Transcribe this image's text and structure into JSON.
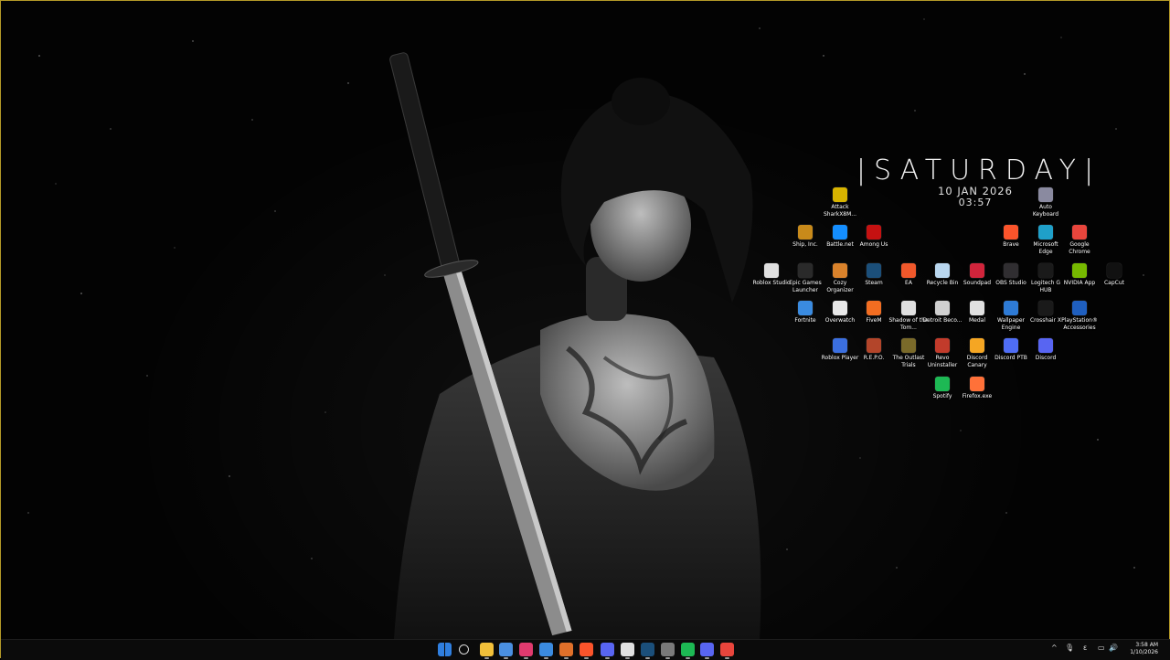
{
  "widget": {
    "day": "|SATURDAY|",
    "date": "10 JAN 2026",
    "time": "03:57"
  },
  "desktop_icons": [
    {
      "label": "Attack SharkX8M...",
      "icon": "attack-shark-icon",
      "color": "#d8b400"
    },
    {
      "label": "Auto Keyboard",
      "icon": "keyboard-icon",
      "color": "#8a8aa0"
    },
    {
      "label": "Ship, Inc.",
      "icon": "ship-inc-icon",
      "color": "#c88a1a"
    },
    {
      "label": "Battle.net",
      "icon": "battlenet-icon",
      "color": "#148eff"
    },
    {
      "label": "Among Us",
      "icon": "among-us-icon",
      "color": "#c51111"
    },
    {
      "label": "Brave",
      "icon": "brave-icon",
      "color": "#fb542b"
    },
    {
      "label": "Microsoft Edge",
      "icon": "edge-icon",
      "color": "#1fa0c9"
    },
    {
      "label": "Google Chrome",
      "icon": "chrome-icon",
      "color": "#e8453c"
    },
    {
      "label": "Roblox Studio",
      "icon": "roblox-studio-icon",
      "color": "#e0e0e0"
    },
    {
      "label": "Epic Games Launcher",
      "icon": "epic-games-icon",
      "color": "#2a2a2a"
    },
    {
      "label": "Cozy Organizer",
      "icon": "cozy-organizer-icon",
      "color": "#d9822b"
    },
    {
      "label": "Steam",
      "icon": "steam-icon",
      "color": "#1b4f7a"
    },
    {
      "label": "EA",
      "icon": "ea-icon",
      "color": "#f0582b"
    },
    {
      "label": "Recycle Bin",
      "icon": "recycle-bin-icon",
      "color": "#b9d7ef"
    },
    {
      "label": "Soundpad",
      "icon": "soundpad-icon",
      "color": "#d1243b"
    },
    {
      "label": "OBS Studio",
      "icon": "obs-icon",
      "color": "#302e31"
    },
    {
      "label": "Logitech G HUB",
      "icon": "logitech-icon",
      "color": "#1a1a1a"
    },
    {
      "label": "NVIDIA App",
      "icon": "nvidia-icon",
      "color": "#76b900"
    },
    {
      "label": "CapCut",
      "icon": "capcut-icon",
      "color": "#111111"
    },
    {
      "label": "Fortnite",
      "icon": "fortnite-icon",
      "color": "#3a8be0"
    },
    {
      "label": "Overwatch",
      "icon": "overwatch-icon",
      "color": "#e8e8e8"
    },
    {
      "label": "FiveM",
      "icon": "fivem-icon",
      "color": "#f26d21"
    },
    {
      "label": "Shadow of the Tom...",
      "icon": "shadow-tomb-raider-icon",
      "color": "#e0e0e0"
    },
    {
      "label": "Detroit Beco...",
      "icon": "detroit-icon",
      "color": "#d0d0d0"
    },
    {
      "label": "Medal",
      "icon": "medal-icon",
      "color": "#e0e0e0"
    },
    {
      "label": "Wallpaper Engine",
      "icon": "wallpaper-engine-icon",
      "color": "#2e7bd6"
    },
    {
      "label": "Crosshair X",
      "icon": "crosshair-x-icon",
      "color": "#1a1a1a"
    },
    {
      "label": "PlayStation® Accessories",
      "icon": "playstation-icon",
      "color": "#1f5fbf"
    },
    {
      "label": "Roblox Player",
      "icon": "roblox-player-icon",
      "color": "#3b6fe0"
    },
    {
      "label": "R.E.P.O.",
      "icon": "repo-icon",
      "color": "#b3452a"
    },
    {
      "label": "The Outlast Trials",
      "icon": "outlast-icon",
      "color": "#7a6a2a"
    },
    {
      "label": "Revo Uninstaller",
      "icon": "revo-icon",
      "color": "#c23b2b"
    },
    {
      "label": "Discord Canary",
      "icon": "discord-canary-icon",
      "color": "#f5a623"
    },
    {
      "label": "Discord PTB",
      "icon": "discord-ptb-icon",
      "color": "#4f6df5"
    },
    {
      "label": "Discord",
      "icon": "discord-icon",
      "color": "#5865f2"
    },
    {
      "label": "Spotify",
      "icon": "spotify-icon",
      "color": "#1db954"
    },
    {
      "label": "Firefox.exe",
      "icon": "firefox-icon",
      "color": "#ff7139"
    }
  ],
  "taskbar": {
    "pinned": [
      {
        "icon": "windows-start-icon",
        "color": "#2f7fe0"
      },
      {
        "icon": "search-icon",
        "color": "#0b0b0b"
      },
      {
        "icon": "file-explorer-icon",
        "color": "#f2c03a"
      },
      {
        "icon": "task-view-icon",
        "color": "#4a8fe0"
      },
      {
        "icon": "tiktok-icon",
        "color": "#e03a6e"
      },
      {
        "icon": "clock-app-icon",
        "color": "#3b8be0"
      },
      {
        "icon": "a-app-icon",
        "color": "#e0702a"
      },
      {
        "icon": "brave-icon",
        "color": "#fb542b"
      },
      {
        "icon": "discord-icon",
        "color": "#5865f2"
      },
      {
        "icon": "game-app-icon",
        "color": "#e0e0e0"
      },
      {
        "icon": "steam-icon",
        "color": "#1b4f7a"
      },
      {
        "icon": "settings-icon",
        "color": "#7a7a7a"
      },
      {
        "icon": "spotify-icon",
        "color": "#1db954"
      },
      {
        "icon": "discord-canary-icon",
        "color": "#5865f2"
      },
      {
        "icon": "chrome-icon",
        "color": "#e8453c"
      }
    ],
    "tray": {
      "chevron": "^",
      "mic": "🎙",
      "lang": "ε",
      "network": "▭",
      "volume": "🔊",
      "battery": "▯"
    },
    "time": "3:58 AM",
    "date": "1/10/2026"
  }
}
